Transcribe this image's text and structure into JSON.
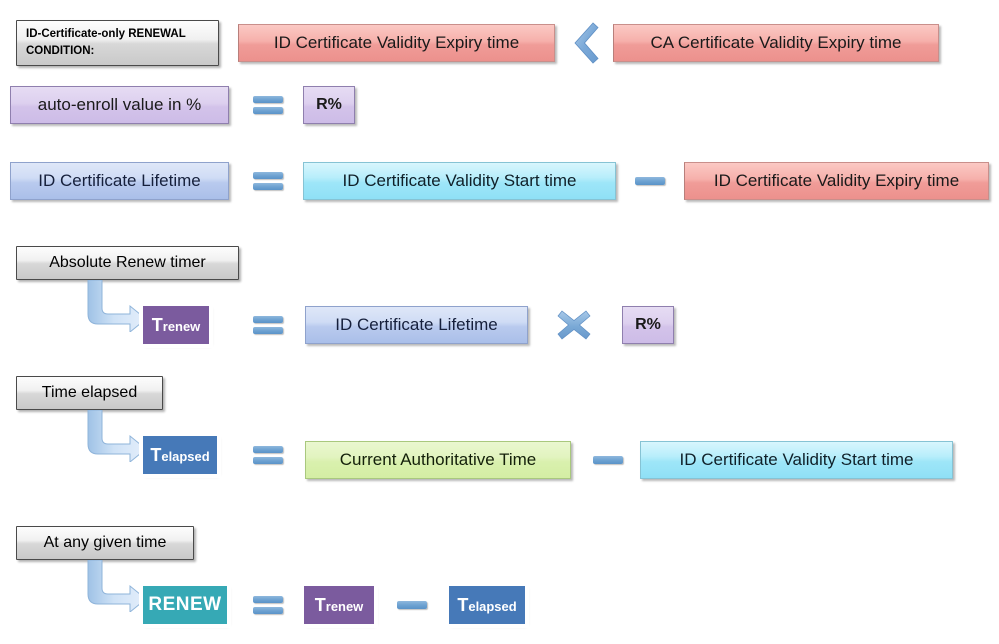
{
  "diagram": {
    "title_box": {
      "line1": "ID-Certificate-only RENEWAL",
      "line2": "CONDITION:"
    },
    "rows": {
      "condition": {
        "left": "ID Certificate Validity Expiry time",
        "operator": "less-than",
        "right": "CA Certificate Validity Expiry time"
      },
      "auto_enroll": {
        "left": "auto-enroll value in %",
        "operator": "equals",
        "right": "R%"
      },
      "lifetime": {
        "left": "ID Certificate Lifetime",
        "operator1": "equals",
        "middle": "ID Certificate Validity Start time",
        "operator2": "minus",
        "right": "ID Certificate Validity Expiry time"
      },
      "absolute_renew": {
        "label": "Absolute Renew timer",
        "chip_main": "T",
        "chip_sub": "renew",
        "operator1": "equals",
        "middle": "ID Certificate Lifetime",
        "operator2": "times",
        "right": "R%"
      },
      "time_elapsed": {
        "label": "Time elapsed",
        "chip_main": "T",
        "chip_sub": "elapsed",
        "operator1": "equals",
        "middle": "Current Authoritative Time",
        "operator2": "minus",
        "right": "ID Certificate Validity Start time"
      },
      "renew": {
        "label": "At any given time",
        "chip_label": "RENEW",
        "operator1": "equals",
        "left_main": "T",
        "left_sub": "renew",
        "operator2": "minus",
        "right_main": "T",
        "right_sub": "elapsed"
      }
    },
    "colors": {
      "red": "#f3a9a4",
      "lavender": "#d6c8ec",
      "periwinkle": "#c2d2f0",
      "cyan": "#a8eaf9",
      "green": "#ddf2b2",
      "gray": "#e2e2e2",
      "chip_purple": "#7b5b9e",
      "chip_blue": "#4679b8",
      "chip_teal": "#36a9b5",
      "operator_blue": "#6fa3d2",
      "arrow_blue": "#b6d3ef"
    }
  }
}
